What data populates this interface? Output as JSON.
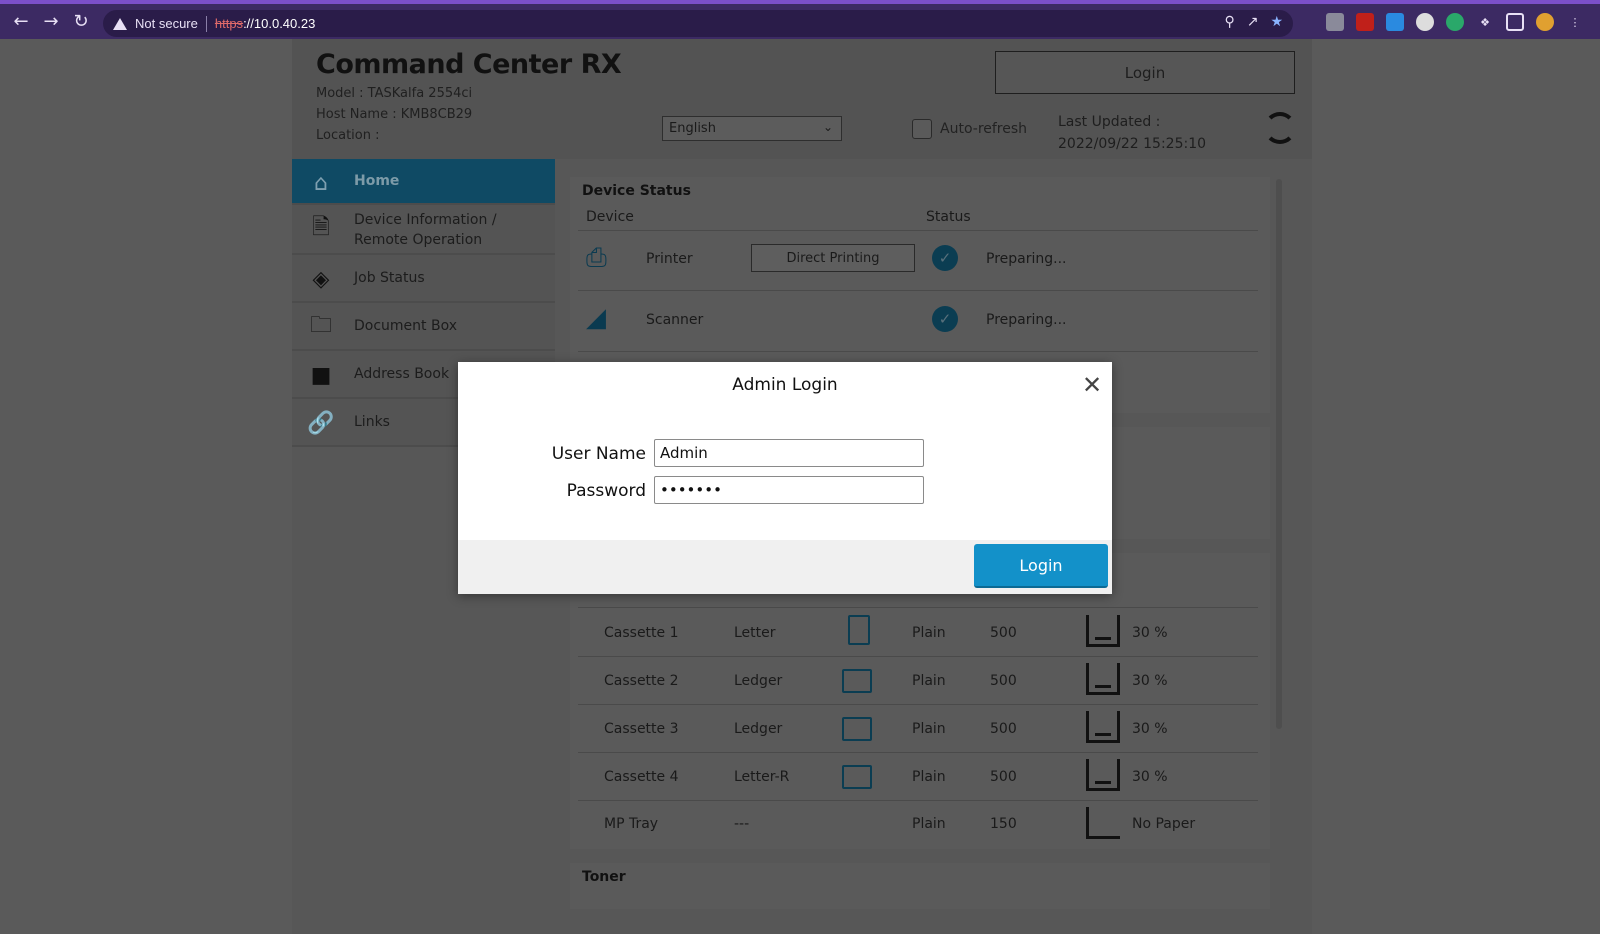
{
  "browser": {
    "security_label": "Not secure",
    "url_scheme": "https",
    "url_rest": "://10.0.40.23"
  },
  "header": {
    "brand": "Command Center RX",
    "model": "Model : TASKalfa 2554ci",
    "host_name": "Host Name : KMB8CB29",
    "location": "Location :",
    "login_label": "Login",
    "language": "English",
    "auto_refresh_label": "Auto-refresh",
    "last_updated_label": "Last Updated :",
    "last_updated_value": "2022/09/22 15:25:10"
  },
  "sidebar": {
    "items": [
      {
        "label": "Home"
      },
      {
        "label": "Device Information /",
        "label2": "Remote Operation"
      },
      {
        "label": "Job Status"
      },
      {
        "label": "Document Box"
      },
      {
        "label": "Address Book"
      },
      {
        "label": "Links"
      }
    ]
  },
  "device_status": {
    "title": "Device Status",
    "col_device": "Device",
    "col_status": "Status",
    "printer_name": "Printer",
    "direct_printing": "Direct Printing",
    "printer_status": "Preparing...",
    "scanner_name": "Scanner",
    "scanner_status": "Preparing..."
  },
  "trays": {
    "rows": [
      {
        "source": "Cassette 1",
        "size": "Letter",
        "type": "Plain",
        "capacity": "500",
        "level": "30 %"
      },
      {
        "source": "Cassette 2",
        "size": "Ledger",
        "type": "Plain",
        "capacity": "500",
        "level": "30 %"
      },
      {
        "source": "Cassette 3",
        "size": "Ledger",
        "type": "Plain",
        "capacity": "500",
        "level": "30 %"
      },
      {
        "source": "Cassette 4",
        "size": "Letter-R",
        "type": "Plain",
        "capacity": "500",
        "level": "30 %"
      },
      {
        "source": "MP Tray",
        "size": "---",
        "type": "Plain",
        "capacity": "150",
        "level": "No Paper"
      }
    ]
  },
  "toner": {
    "title": "Toner"
  },
  "modal": {
    "title": "Admin Login",
    "user_label": "User Name",
    "user_value": "Admin",
    "password_label": "Password",
    "password_value": "•••••••",
    "login_label": "Login"
  }
}
